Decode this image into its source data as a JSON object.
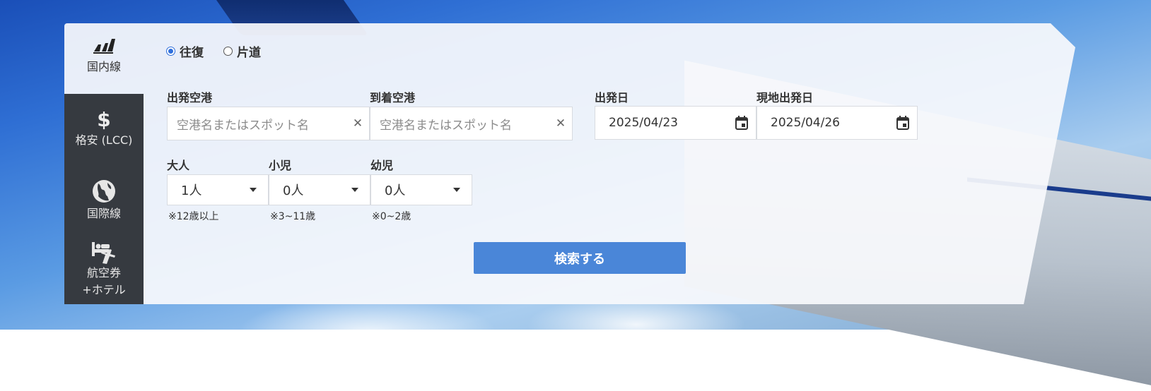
{
  "sidebar": {
    "tabs": [
      {
        "label": "国内線",
        "icon": "domestic-flight-icon"
      },
      {
        "label": "格安 (LCC)",
        "icon": "dollar-icon"
      },
      {
        "label": "国際線",
        "icon": "globe-icon"
      },
      {
        "label": "航空券\n+ホテル",
        "icon": "flight-hotel-icon"
      }
    ],
    "active_tab": "国内線"
  },
  "trip_type": {
    "options": [
      {
        "label": "往復",
        "checked": true
      },
      {
        "label": "片道",
        "checked": false
      }
    ]
  },
  "departure_airport": {
    "label": "出発空港",
    "placeholder": "空港名またはスポット名"
  },
  "arrival_airport": {
    "label": "到着空港",
    "placeholder": "空港名またはスポット名"
  },
  "departure_date": {
    "label": "出発日",
    "value": "2025/04/23"
  },
  "return_date": {
    "label": "現地出発日",
    "value": "2025/04/26"
  },
  "passengers": {
    "adult": {
      "label": "大人",
      "value": "1人",
      "note": "※12歳以上"
    },
    "child": {
      "label": "小児",
      "value": "0人",
      "note": "※3~11歳"
    },
    "infant": {
      "label": "幼児",
      "value": "0人",
      "note": "※0~2歳"
    }
  },
  "search_button": {
    "label": "検索する"
  },
  "colors": {
    "accent": "#4a86d8",
    "sidebar_bg": "#363a40",
    "radio_checked": "#2f6fdc"
  }
}
